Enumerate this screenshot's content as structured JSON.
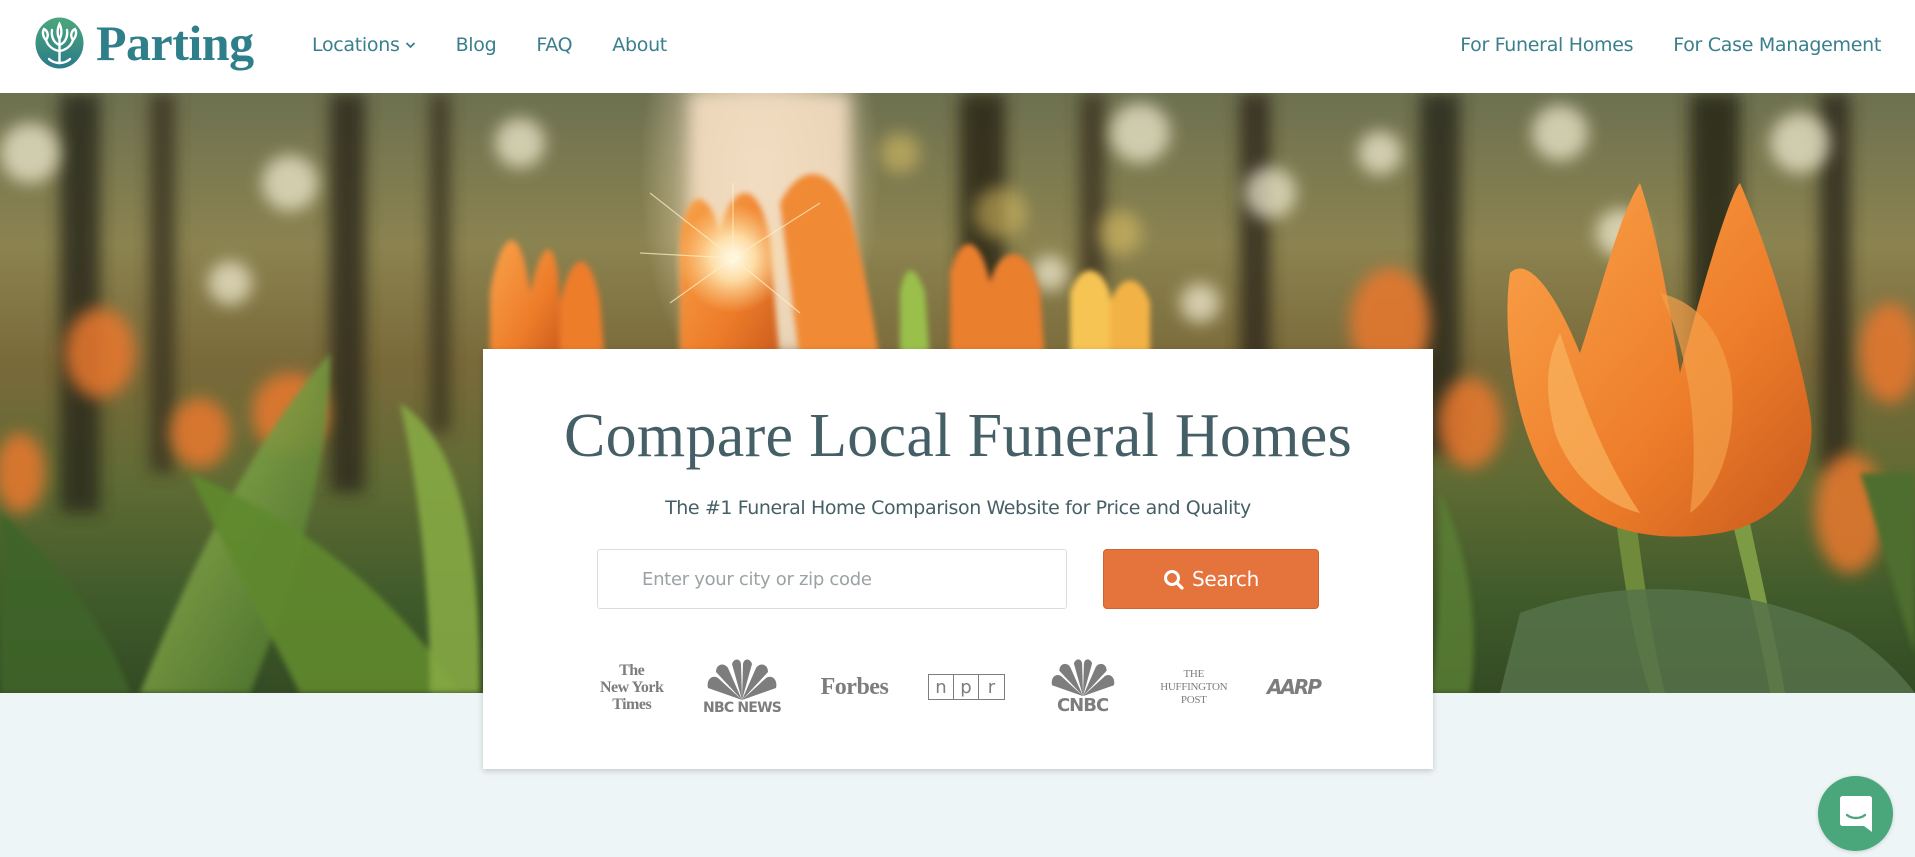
{
  "header": {
    "brand": "Parting",
    "nav_left": [
      {
        "label": "Locations",
        "has_dropdown": true
      },
      {
        "label": "Blog"
      },
      {
        "label": "FAQ"
      },
      {
        "label": "About"
      }
    ],
    "nav_right": [
      {
        "label": "For Funeral Homes"
      },
      {
        "label": "For Case Management"
      }
    ]
  },
  "hero": {
    "title": "Compare Local Funeral Homes",
    "subtitle": "The #1 Funeral Home Comparison Website for Price and Quality",
    "search": {
      "placeholder": "Enter your city or zip code",
      "value": "",
      "button_label": "Search",
      "button_icon": "search-icon"
    },
    "press": {
      "nyt": [
        "The",
        "New York",
        "Times"
      ],
      "nbc": "NBC NEWS",
      "forbes": "Forbes",
      "npr": [
        "n",
        "p",
        "r"
      ],
      "cnbc": "CNBC",
      "huffpost": [
        "THE",
        "HUFFINGTON",
        "POST"
      ],
      "aarp": "AARP"
    }
  },
  "chat": {
    "icon": "chat-bubble-icon"
  },
  "colors": {
    "brand_teal": "#2f7f8b",
    "nav_text": "#3a7f8c",
    "heading": "#455f66",
    "accent_orange": "#e5733c",
    "chat_green": "#4aa77c",
    "page_bg": "#eef5f6",
    "press_gray": "#7d7d7d"
  }
}
